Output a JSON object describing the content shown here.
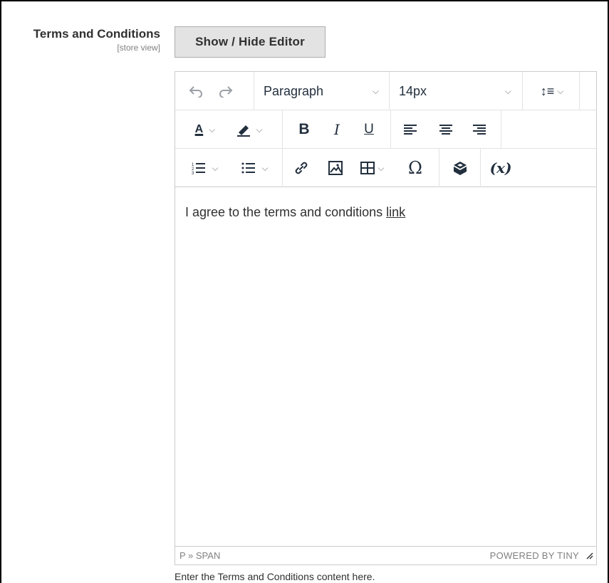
{
  "field": {
    "label": "Terms and Conditions",
    "scope": "[store view]"
  },
  "show_hide_button": "Show / Hide Editor",
  "toolbar": {
    "block_format": "Paragraph",
    "font_size": "14px",
    "bold": "B",
    "italic": "I",
    "underline": "U",
    "variable": "(x)"
  },
  "content": {
    "text": "I agree to the terms and conditions ",
    "link": "link"
  },
  "statusbar": {
    "path": "P » SPAN",
    "brand": "POWERED BY TINY"
  },
  "note": "Enter the Terms and Conditions content here."
}
